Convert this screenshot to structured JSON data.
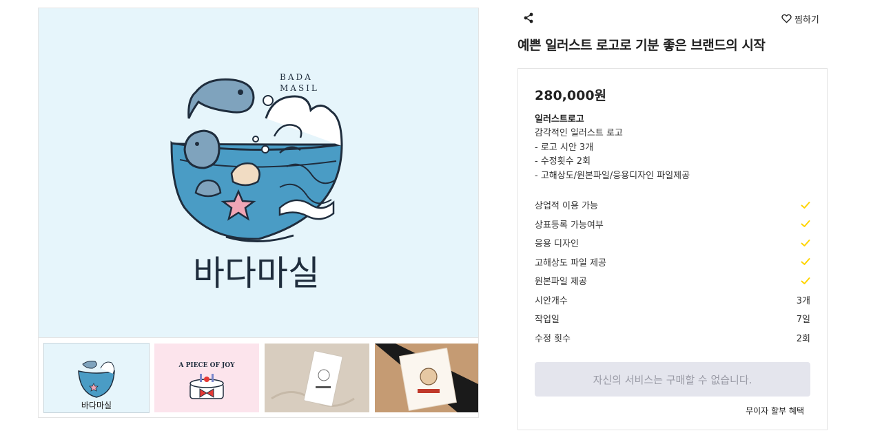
{
  "gallery": {
    "main_image": {
      "brand_en_line1": "BADA",
      "brand_en_line2": "MASIL",
      "brand_ko": "바다마실",
      "background": "#e6f5fb"
    },
    "thumbnails": [
      {
        "name": "thumb-bada-masil",
        "title": "바다마실",
        "active": true
      },
      {
        "name": "thumb-piece-of-joy",
        "title": "A PIECE OF JOY"
      },
      {
        "name": "thumb-business-card",
        "title": ""
      },
      {
        "name": "thumb-card-on-table",
        "title": ""
      }
    ]
  },
  "header": {
    "share_icon": "share-icon",
    "wish_label": "찜하기",
    "wish_icon": "heart-outline-icon"
  },
  "service": {
    "title": "예쁜 일러스트 로고로 기분 좋은 브랜드의 시작"
  },
  "package": {
    "price": "280,000원",
    "name": "일러스트로고",
    "description": [
      "감각적인 일러스트 로고",
      "- 로고 시안 3개",
      "- 수정횟수 2회",
      "- 고해상도/원본파일/응용디자인 파일제공"
    ],
    "features": [
      {
        "label": "상업적 이용 가능",
        "check": true
      },
      {
        "label": "상표등록 가능여부",
        "check": true
      },
      {
        "label": "응용 디자인",
        "check": true
      },
      {
        "label": "고해상도 파일 제공",
        "check": true
      },
      {
        "label": "원본파일 제공",
        "check": true
      },
      {
        "label": "시안개수",
        "value": "3개"
      },
      {
        "label": "작업일",
        "value": "7일"
      },
      {
        "label": "수정 횟수",
        "value": "2회"
      }
    ],
    "buy_button_label": "자신의 서비스는 구매할 수 없습니다.",
    "installment_label": "무이자 할부 혜택",
    "check_color": "#ffd400"
  }
}
